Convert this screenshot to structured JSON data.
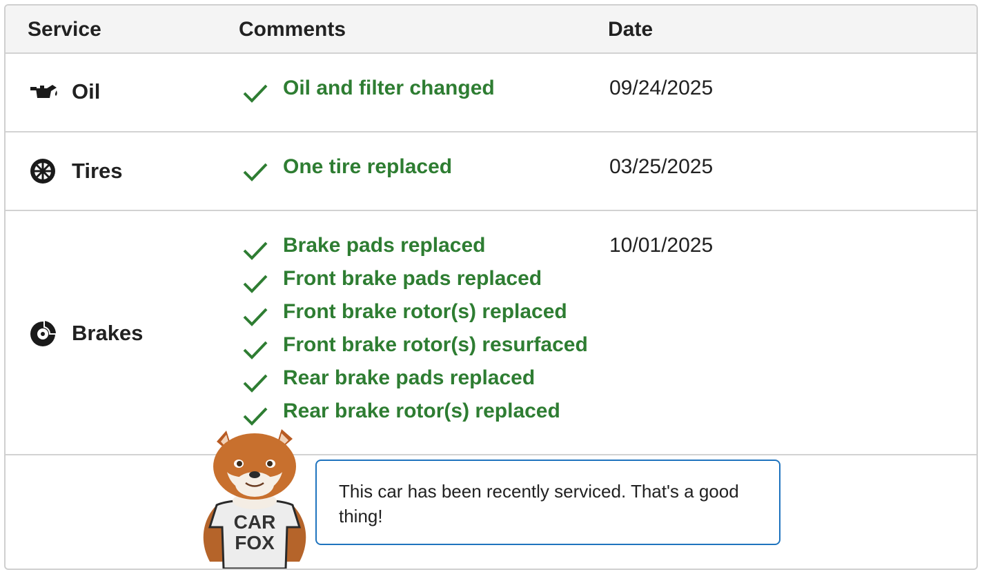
{
  "table": {
    "headers": {
      "service": "Service",
      "comments": "Comments",
      "date": "Date"
    },
    "rows": [
      {
        "service": "Oil",
        "icon": "oil-can-icon",
        "comments": [
          "Oil and filter changed"
        ],
        "date": "09/24/2025"
      },
      {
        "service": "Tires",
        "icon": "tire-icon",
        "comments": [
          "One tire replaced"
        ],
        "date": "03/25/2025"
      },
      {
        "service": "Brakes",
        "icon": "brake-disc-icon",
        "comments": [
          "Brake pads replaced",
          "Front brake pads replaced",
          "Front brake rotor(s) replaced",
          "Front brake rotor(s) resurfaced",
          "Rear brake pads replaced",
          "Rear brake rotor(s) replaced"
        ],
        "date": "10/01/2025"
      }
    ]
  },
  "mascot": {
    "shirt_text": "CAR FOX",
    "message": "This car has been recently serviced. That's a good thing!"
  },
  "colors": {
    "check_green": "#2e7d32",
    "bubble_border": "#1e73be",
    "header_bg": "#f4f4f4"
  }
}
